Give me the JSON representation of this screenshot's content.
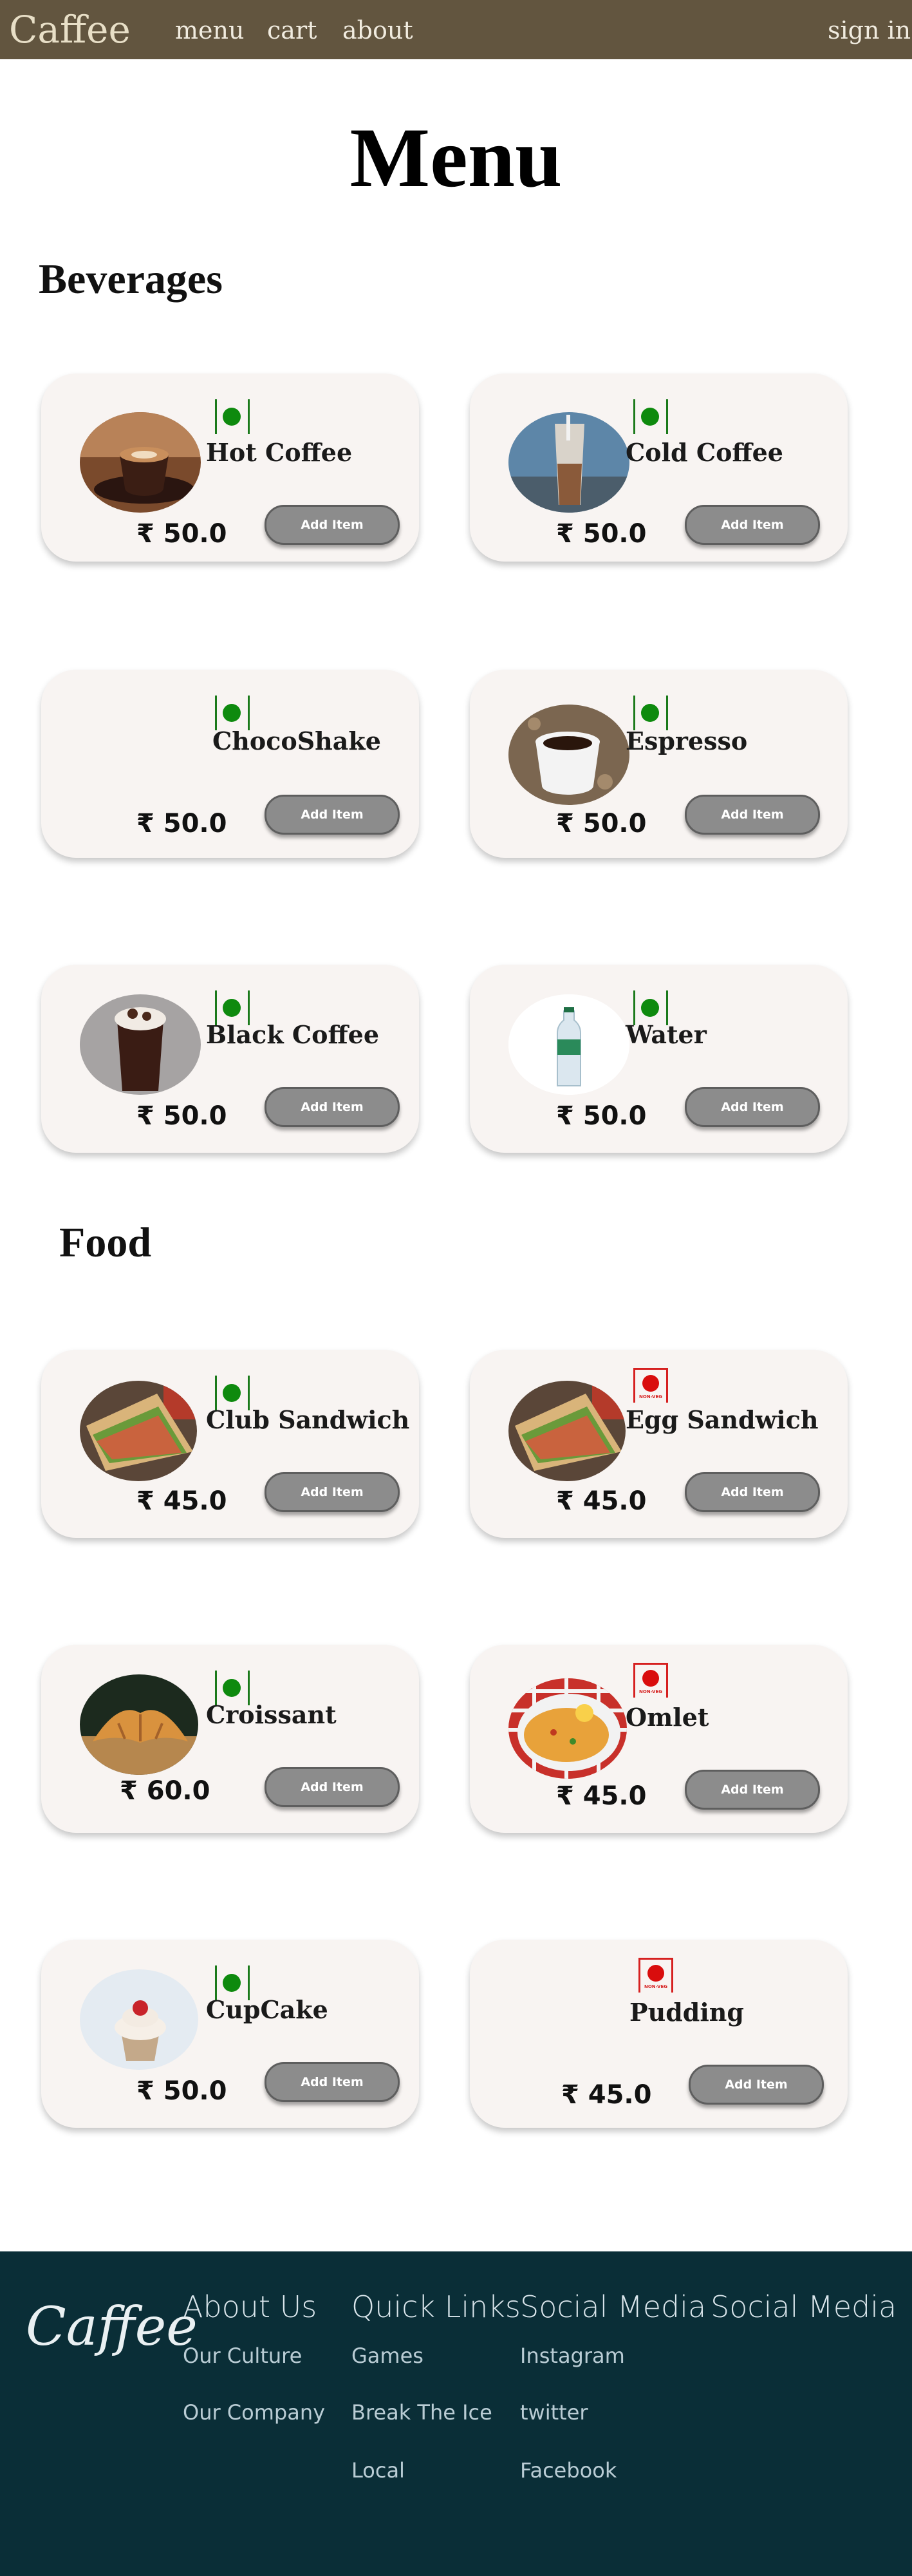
{
  "navbar": {
    "brand": "Caffee",
    "links": {
      "menu": "menu",
      "cart": "cart",
      "about": "about"
    },
    "sign_in": "sign in",
    "background": "#62553f"
  },
  "page_title": "Menu",
  "sections": {
    "beverages": {
      "title": "Beverages",
      "items": [
        {
          "name": "Hot Coffee",
          "price": "₹ 50.0",
          "button": "Add Item",
          "diet": "veg"
        },
        {
          "name": "Cold Coffee",
          "price": "₹ 50.0",
          "button": "Add Item",
          "diet": "veg"
        },
        {
          "name": "ChocoShake",
          "price": "₹ 50.0",
          "button": "Add Item",
          "diet": "veg"
        },
        {
          "name": "Espresso",
          "price": "₹ 50.0",
          "button": "Add Item",
          "diet": "veg"
        },
        {
          "name": "Black Coffee",
          "price": "₹ 50.0",
          "button": "Add Item",
          "diet": "veg"
        },
        {
          "name": "Water",
          "price": "₹ 50.0",
          "button": "Add Item",
          "diet": "veg"
        }
      ]
    },
    "food": {
      "title": "Food",
      "items": [
        {
          "name": "Club Sandwich",
          "price": "₹ 45.0",
          "button": "Add Item",
          "diet": "veg"
        },
        {
          "name": "Egg Sandwich",
          "price": "₹ 45.0",
          "button": "Add Item",
          "diet": "non-veg"
        },
        {
          "name": "Croissant",
          "price": "₹ 60.0",
          "button": "Add Item",
          "diet": "veg"
        },
        {
          "name": "Omlet",
          "price": "₹ 45.0",
          "button": "Add Item",
          "diet": "non-veg"
        },
        {
          "name": "CupCake",
          "price": "₹ 50.0",
          "button": "Add Item",
          "diet": "veg"
        },
        {
          "name": "Pudding",
          "price": "₹ 45.0",
          "button": "Add Item",
          "diet": "non-veg"
        }
      ]
    }
  },
  "nonveg_label": "NON-VEG",
  "footer": {
    "logo": "Caffee",
    "columns": [
      {
        "heading": "About Us",
        "links": [
          "Our Culture",
          "Our Company"
        ]
      },
      {
        "heading": "Quick Links",
        "links": [
          "Games",
          "Break The Ice",
          "Local"
        ]
      },
      {
        "heading": "Social Media",
        "links": [
          "Instagram",
          "twitter",
          "Facebook"
        ]
      },
      {
        "heading": "Social Media",
        "links": []
      }
    ],
    "background": "#0a2e37"
  },
  "colors": {
    "veg": "#0e8a0e",
    "nonveg": "#d90d0d",
    "button": "#8c8c8c"
  }
}
